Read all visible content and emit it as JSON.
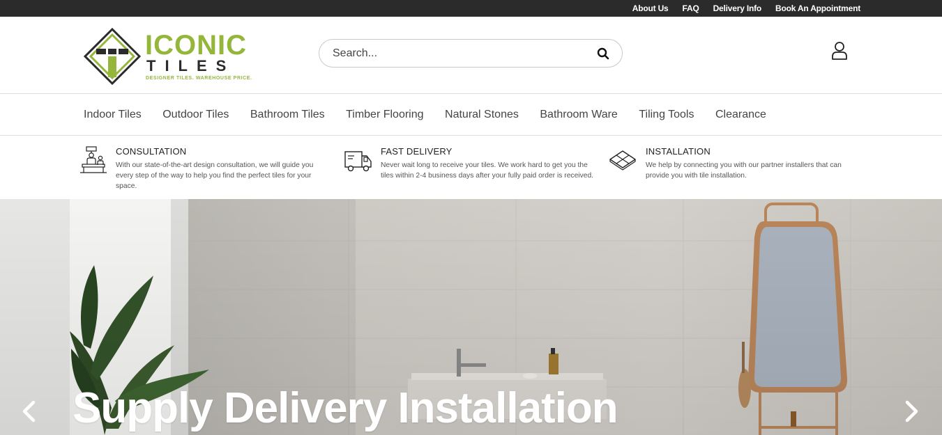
{
  "top_links": [
    "About Us",
    "FAQ",
    "Delivery Info",
    "Book An Appointment"
  ],
  "logo": {
    "word1": "ICONIC",
    "word2": "TILES",
    "tagline": "DESIGNER TILES. WAREHOUSE PRICE."
  },
  "search": {
    "placeholder": "Search...",
    "icon": "search-icon"
  },
  "account": {
    "icon": "user-icon"
  },
  "nav": [
    "Indoor Tiles",
    "Outdoor Tiles",
    "Bathroom Tiles",
    "Timber Flooring",
    "Natural Stones",
    "Bathroom Ware",
    "Tiling Tools",
    "Clearance"
  ],
  "features": [
    {
      "icon": "consultation-icon",
      "title": "CONSULTATION",
      "text": "With our state-of-the-art design consultation, we will guide you every step of the way to help you find the perfect tiles for your space."
    },
    {
      "icon": "delivery-truck-icon",
      "title": "FAST DELIVERY",
      "text": "Never wait long to receive your tiles. We work hard to get you the tiles within 2-4 business days after your fully paid order is received."
    },
    {
      "icon": "installation-tiles-icon",
      "title": "INSTALLATION",
      "text": "We help by connecting you with our partner installers that can provide you with tile installation."
    }
  ],
  "hero": {
    "title": "Supply Delivery Installation"
  },
  "colors": {
    "brand_green": "#94b73b",
    "topbar": "#2b2b2b"
  }
}
